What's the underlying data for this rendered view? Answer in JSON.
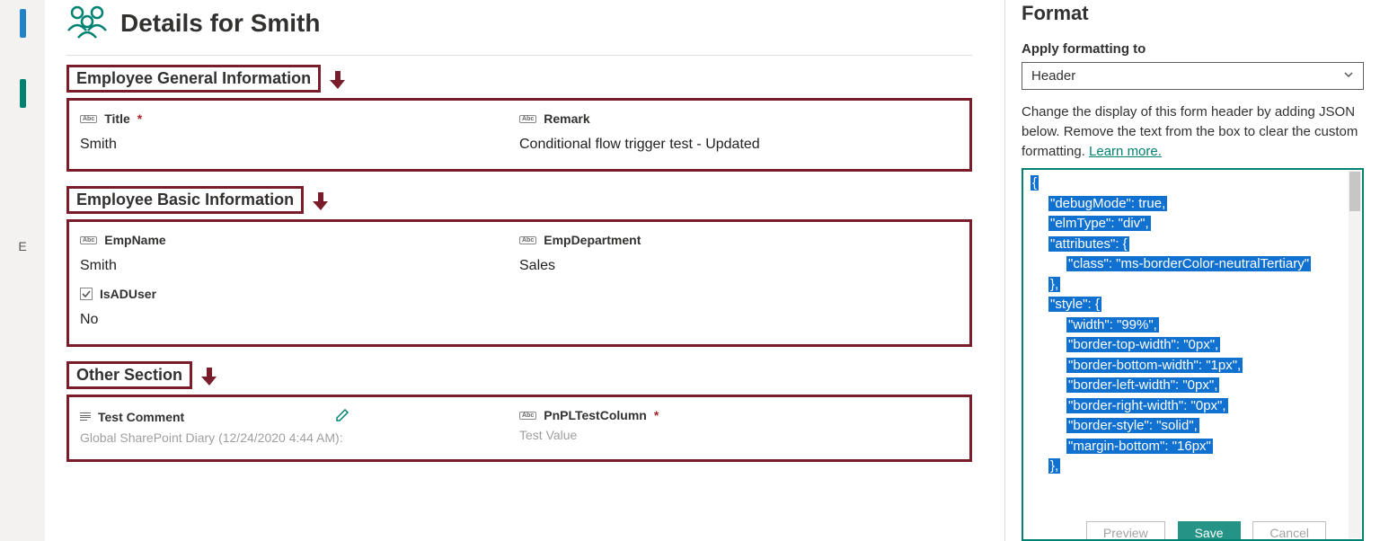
{
  "leftRail": {
    "truncated": "E"
  },
  "header": {
    "title": "Details for Smith"
  },
  "sections": [
    {
      "title": "Employee General Information"
    },
    {
      "title": "Employee Basic Information"
    },
    {
      "title": "Other Section"
    }
  ],
  "fields": {
    "title": {
      "label": "Title",
      "value": "Smith"
    },
    "remark": {
      "label": "Remark",
      "value": "Conditional flow trigger test - Updated"
    },
    "empName": {
      "label": "EmpName",
      "value": "Smith"
    },
    "empDept": {
      "label": "EmpDepartment",
      "value": "Sales"
    },
    "isAD": {
      "label": "IsADUser",
      "value": "No"
    },
    "testComment": {
      "label": "Test Comment",
      "sub": "Global SharePoint Diary (12/24/2020 4:44 AM):"
    },
    "pnpl": {
      "label": "PnPLTestColumn",
      "value": "Test Value"
    }
  },
  "format": {
    "panelTitle": "Format",
    "applyLabel": "Apply formatting to",
    "dropdown": "Header",
    "desc1": "Change the display of this form header by adding JSON below. Remove the text from the box to clear the custom formatting. ",
    "learn": "Learn more.",
    "json": {
      "l0": "{",
      "l1": "\"debugMode\": true,",
      "l2": "\"elmType\": \"div\",",
      "l3": "\"attributes\": {",
      "l4": "\"class\": \"ms-borderColor-neutralTertiary\"",
      "l5": "},",
      "l6": "\"style\": {",
      "l7": "\"width\": \"99%\",",
      "l8": "\"border-top-width\": \"0px\",",
      "l9": "\"border-bottom-width\": \"1px\",",
      "l10": "\"border-left-width\": \"0px\",",
      "l11": "\"border-right-width\": \"0px\",",
      "l12": "\"border-style\": \"solid\",",
      "l13": "\"margin-bottom\": \"16px\"",
      "l14": "},"
    },
    "btnPreview": "Preview",
    "btnSave": "Save",
    "btnCancel": "Cancel"
  }
}
